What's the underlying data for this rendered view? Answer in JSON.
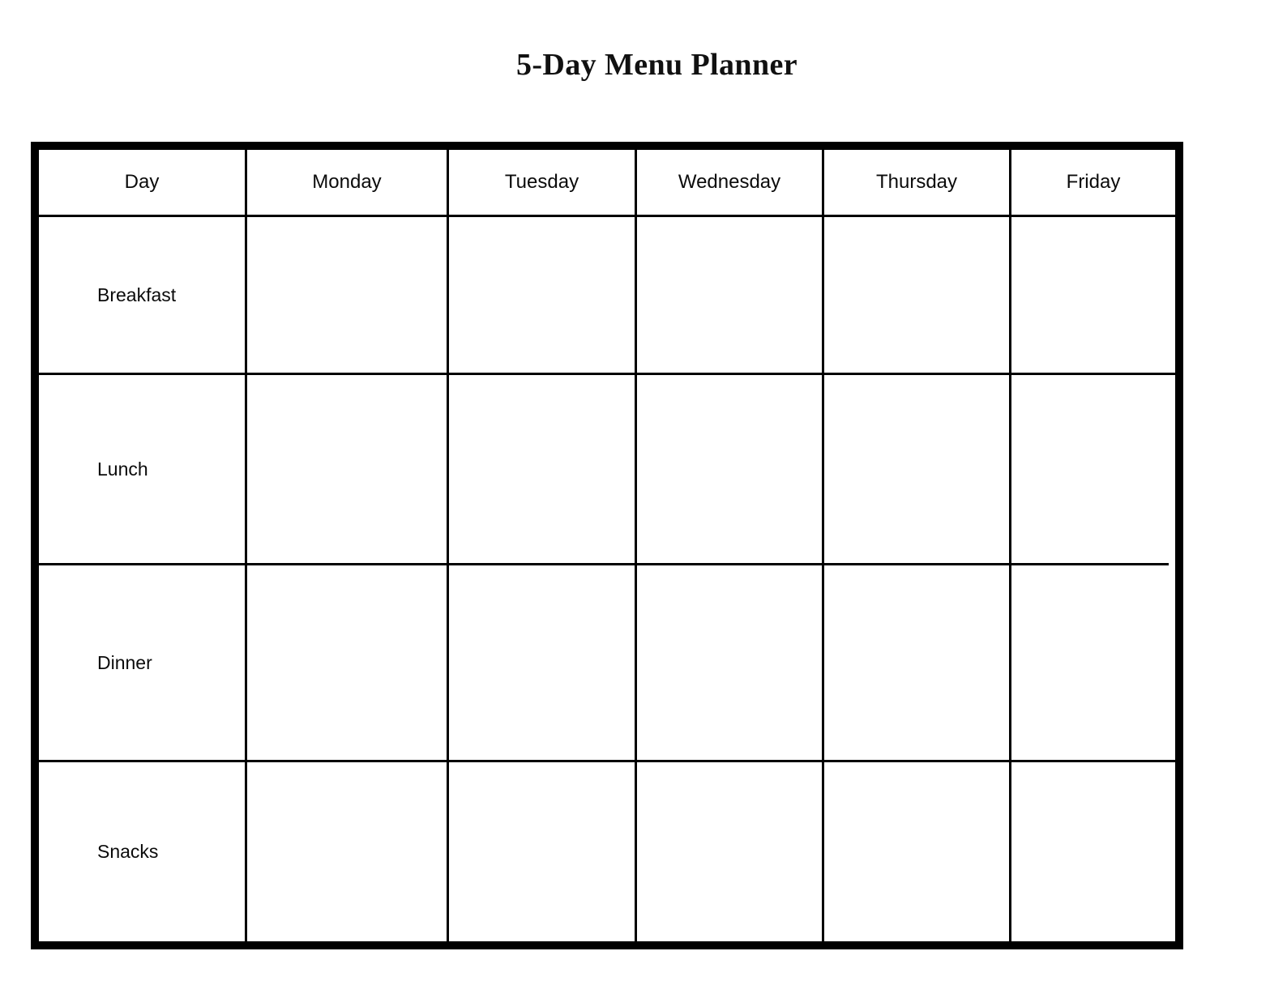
{
  "document": {
    "title": "5-Day Menu Planner",
    "background_color": "#ffffff",
    "border_color": "#000000",
    "text_color": "#000000"
  },
  "table": {
    "columns": [
      {
        "key": "day",
        "label": "Day"
      },
      {
        "key": "monday",
        "label": "Monday"
      },
      {
        "key": "tuesday",
        "label": "Tuesday"
      },
      {
        "key": "wednesday",
        "label": "Wednesday"
      },
      {
        "key": "thursday",
        "label": "Thursday"
      },
      {
        "key": "friday",
        "label": "Friday"
      }
    ],
    "rows": [
      {
        "label": "Breakfast",
        "cells": {
          "monday": "",
          "tuesday": "",
          "wednesday": "",
          "thursday": "",
          "friday": ""
        }
      },
      {
        "label": "Lunch",
        "cells": {
          "monday": "",
          "tuesday": "",
          "wednesday": "",
          "thursday": "",
          "friday": ""
        }
      },
      {
        "label": "Dinner",
        "cells": {
          "monday": "",
          "tuesday": "",
          "wednesday": "",
          "thursday": "",
          "friday": ""
        }
      },
      {
        "label": "Snacks",
        "cells": {
          "monday": "",
          "tuesday": "",
          "wednesday": "",
          "thursday": "",
          "friday": ""
        }
      }
    ]
  }
}
